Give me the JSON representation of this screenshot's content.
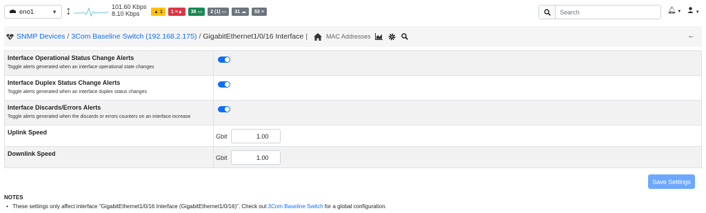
{
  "topbar": {
    "interface": "eno1",
    "rate_up": "101.60 Kbps",
    "rate_down": "8.10 Kbps",
    "badges": [
      {
        "count": "1",
        "icon": "warning-icon",
        "color": "#ffc107"
      },
      {
        "count": "1",
        "icon": "flow-alert-icon",
        "color": "#dc3545"
      },
      {
        "count": "38",
        "icon": "device-icon",
        "color": "#198754"
      },
      {
        "count": "2 (1)",
        "icon": "laptop-icon",
        "color": "#6c757d"
      },
      {
        "count": "31",
        "icon": "host-icon",
        "color": "#6c757d"
      },
      {
        "count": "53",
        "icon": "flows-icon",
        "color": "#6c757d"
      }
    ],
    "search_placeholder": "Search"
  },
  "breadcrumb": {
    "snmp_devices": "SNMP Devices",
    "sep1": "/",
    "device": "3Com Baseline Switch (192.168.2.175)",
    "sep2": "/",
    "current": "GigabitEthernet1/0/16 Interface",
    "sep3": "|",
    "mac_addresses": "MAC Addresses"
  },
  "settings": [
    {
      "title": "Interface Operational Status Change Alerts",
      "desc": "Toggle alerts generated when an interface operational state changes",
      "enabled": true
    },
    {
      "title": "Interface Duplex Status Change Alerts",
      "desc": "Toggle alerts generated when an interface duplex status changes",
      "enabled": true
    },
    {
      "title": "Interface Discards/Errors Alerts",
      "desc": "Toggle alerts generated when the discards or errors counters on an interface increase",
      "enabled": true
    }
  ],
  "speeds": {
    "uplink_label": "Uplink Speed",
    "uplink_unit": "Gbit",
    "uplink_value": "1.00",
    "downlink_label": "Downlink Speed",
    "downlink_unit": "Gbit",
    "downlink_value": "1.00"
  },
  "save_label": "Save Settings",
  "notes": {
    "title": "NOTES",
    "text_before": "These settings only affect interface \"GigabitEthernet1/0/16 Interface (GigabitEthernet1/0/16)\". Check out ",
    "link": "3Com Baseline Switch",
    "text_after": " for a global configuration."
  },
  "colors": {
    "accent": "#0d6efd",
    "save_button": "#6ea8fe"
  }
}
